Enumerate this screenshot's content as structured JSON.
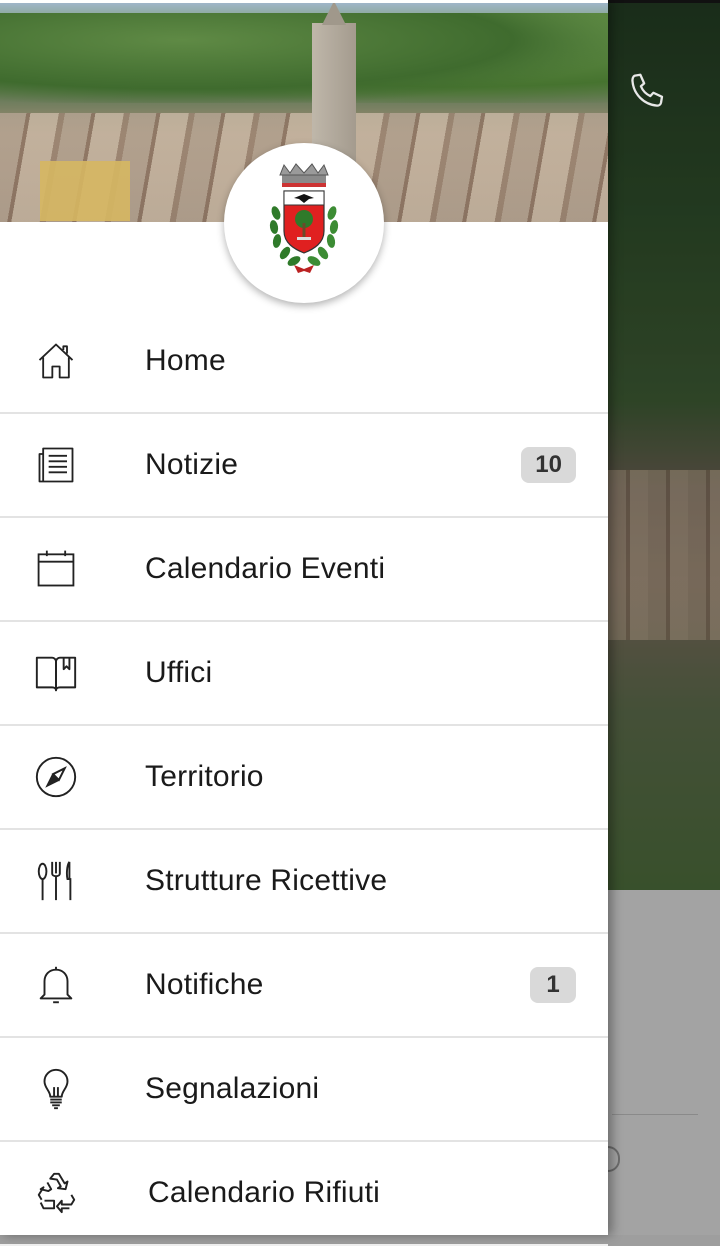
{
  "app": {
    "background_action": {
      "icon": "phone-icon"
    }
  },
  "drawer": {
    "logo": {
      "icon": "coat-of-arms-icon"
    },
    "items": [
      {
        "label": "Home",
        "icon": "home-icon",
        "badge": null
      },
      {
        "label": "Notizie",
        "icon": "newspaper-icon",
        "badge": "10"
      },
      {
        "label": "Calendario Eventi",
        "icon": "calendar-icon",
        "badge": null
      },
      {
        "label": "Uffici",
        "icon": "book-icon",
        "badge": null
      },
      {
        "label": "Territorio",
        "icon": "compass-icon",
        "badge": null
      },
      {
        "label": "Strutture Ricettive",
        "icon": "fork-knife-icon",
        "badge": null
      },
      {
        "label": "Notifiche",
        "icon": "bell-icon",
        "badge": "1"
      },
      {
        "label": "Segnalazioni",
        "icon": "lightbulb-icon",
        "badge": null
      },
      {
        "label": "Calendario Rifiuti",
        "icon": "recycle-icon",
        "badge": null
      }
    ]
  },
  "colors": {
    "drawer_bg": "#ffffff",
    "divider": "#e3e3e3",
    "badge_bg": "#d9d9d9",
    "text": "#1a1a1a",
    "crest_red": "#e02020",
    "crest_green": "#2f7a2a"
  }
}
